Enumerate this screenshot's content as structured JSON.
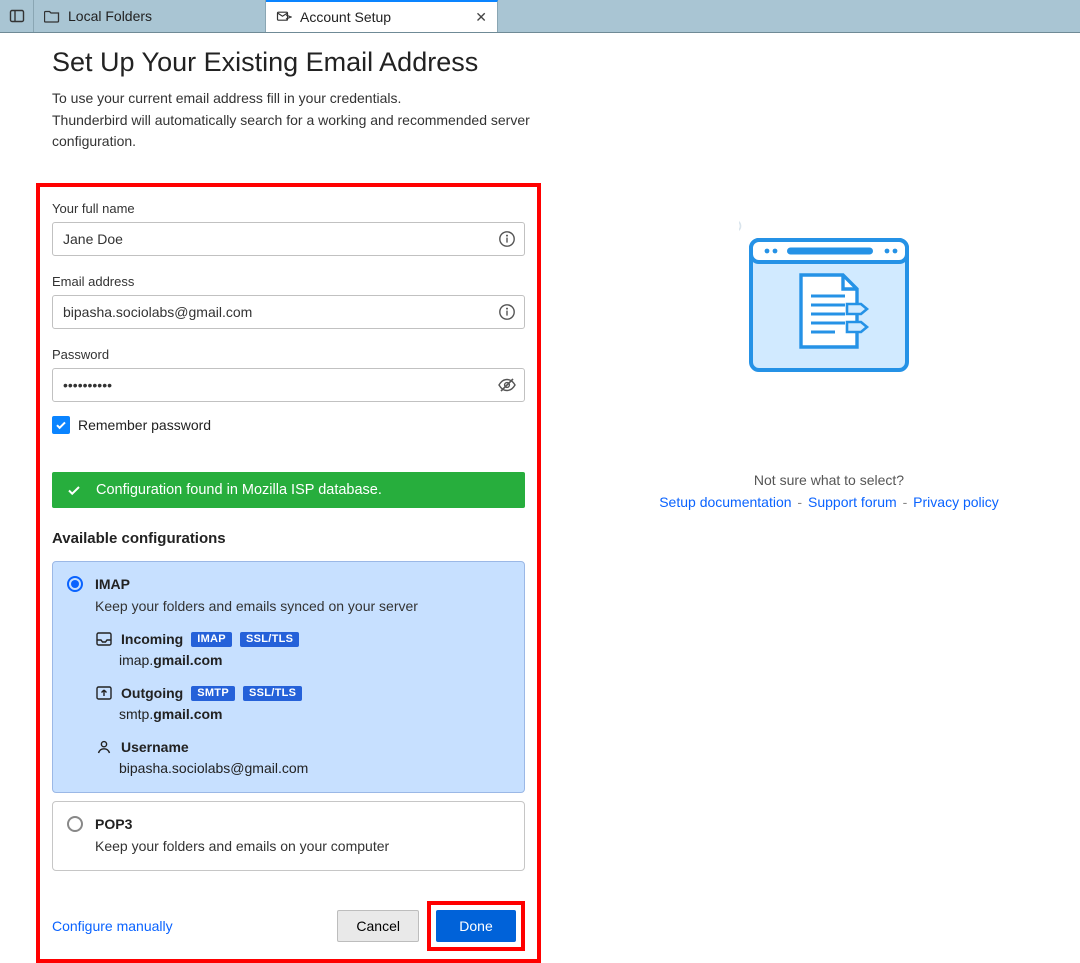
{
  "tabs": {
    "first": "Local Folders",
    "second": "Account Setup"
  },
  "heading": "Set Up Your Existing Email Address",
  "intro1": "To use your current email address fill in your credentials.",
  "intro2": "Thunderbird will automatically search for a working and recommended server configuration.",
  "form": {
    "fullname_label": "Your full name",
    "fullname_value": "Jane Doe",
    "email_label": "Email address",
    "email_value": "bipasha.sociolabs@gmail.com",
    "password_label": "Password",
    "password_value": "••••••••••",
    "remember_label": "Remember password"
  },
  "status": "Configuration found in Mozilla ISP database.",
  "available_title": "Available configurations",
  "imap": {
    "title": "IMAP",
    "desc": "Keep your folders and emails synced on your server",
    "incoming_label": "Incoming",
    "incoming_badge1": "IMAP",
    "incoming_badge2": "SSL/TLS",
    "incoming_server_pre": "imap.",
    "incoming_server_bold": "gmail.com",
    "outgoing_label": "Outgoing",
    "outgoing_badge1": "SMTP",
    "outgoing_badge2": "SSL/TLS",
    "outgoing_server_pre": "smtp.",
    "outgoing_server_bold": "gmail.com",
    "username_label": "Username",
    "username_value": "bipasha.sociolabs@gmail.com"
  },
  "pop3": {
    "title": "POP3",
    "desc": "Keep your folders and emails on your computer"
  },
  "footer": {
    "configure": "Configure manually",
    "cancel": "Cancel",
    "done": "Done"
  },
  "right": {
    "nothelp": "Not sure what to select?",
    "link1": "Setup documentation",
    "link2": "Support forum",
    "link3": "Privacy policy"
  }
}
